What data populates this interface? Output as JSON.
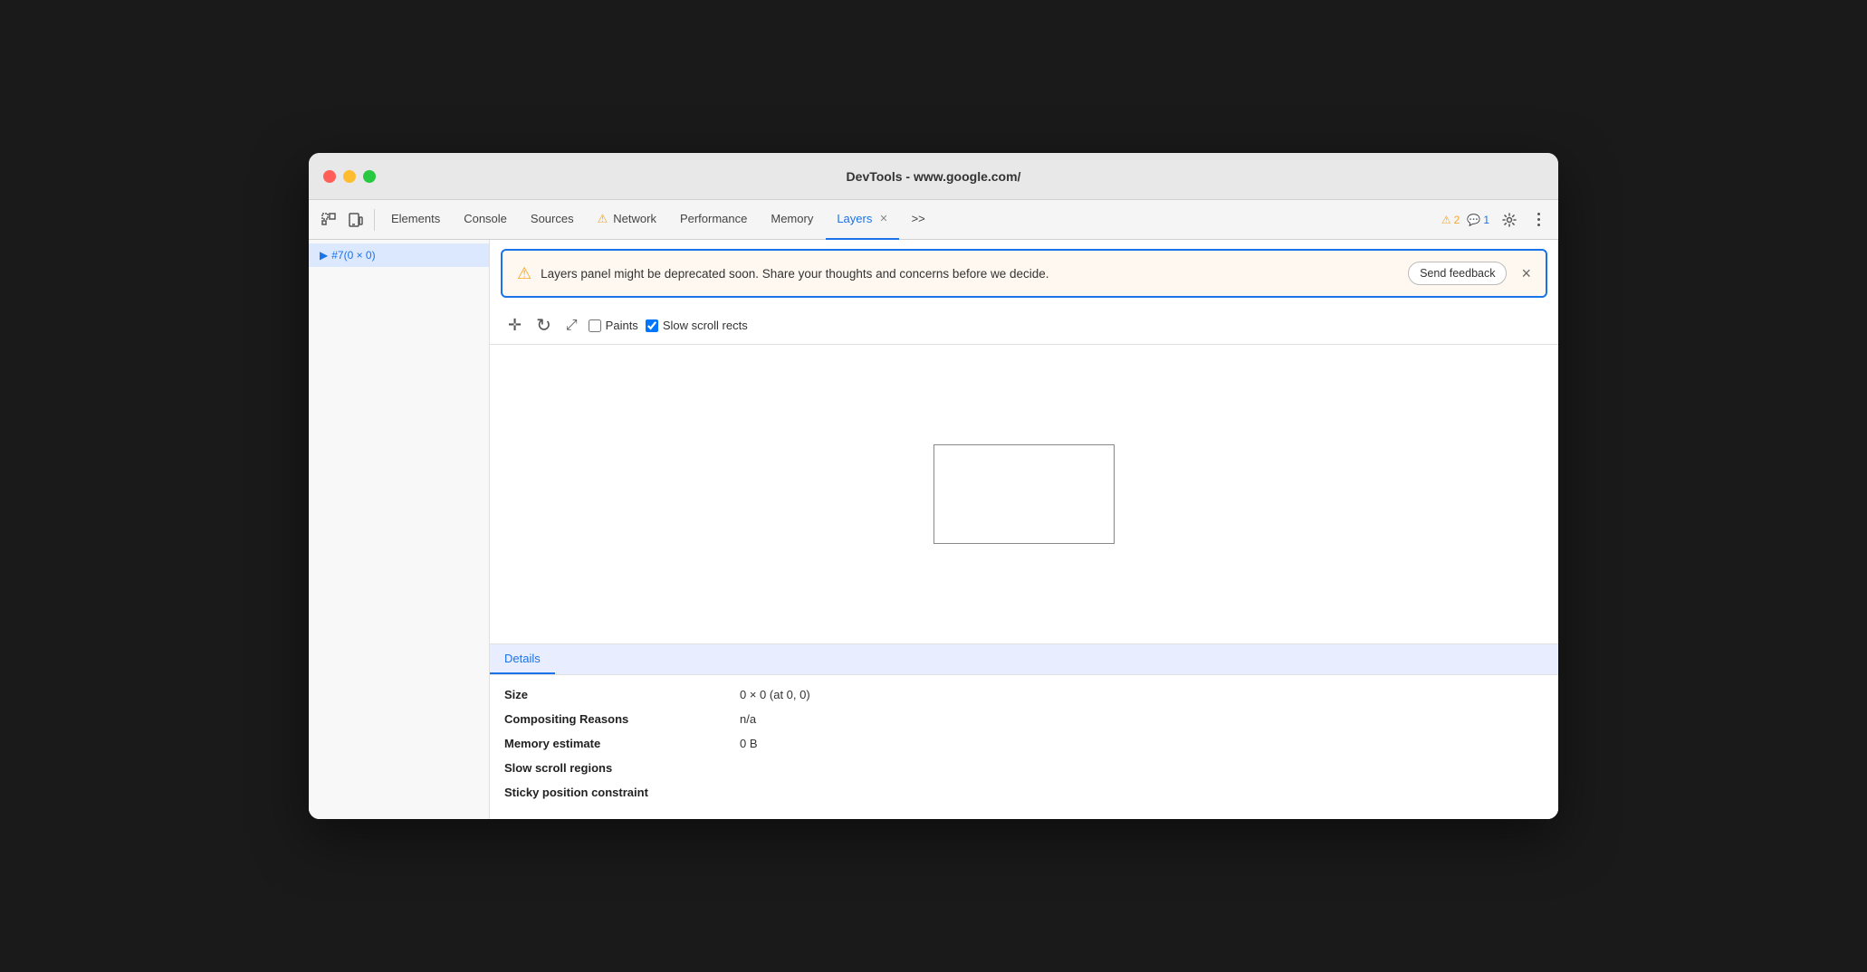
{
  "window": {
    "title": "DevTools - www.google.com/"
  },
  "toolbar": {
    "inspect_label": "Inspect",
    "device_label": "Device",
    "tabs": [
      {
        "id": "elements",
        "label": "Elements",
        "active": false
      },
      {
        "id": "console",
        "label": "Console",
        "active": false
      },
      {
        "id": "sources",
        "label": "Sources",
        "active": false
      },
      {
        "id": "network",
        "label": "Network",
        "active": false,
        "warning": true
      },
      {
        "id": "performance",
        "label": "Performance",
        "active": false
      },
      {
        "id": "memory",
        "label": "Memory",
        "active": false
      },
      {
        "id": "layers",
        "label": "Layers",
        "active": true,
        "closeable": true
      }
    ],
    "more_tabs": ">>",
    "warning_count": "2",
    "info_count": "1",
    "settings_label": "Settings",
    "more_options_label": "More options"
  },
  "sidebar": {
    "items": [
      {
        "id": "layer1",
        "label": "#7(0 × 0)",
        "selected": true,
        "expandable": true
      }
    ]
  },
  "banner": {
    "message": "Layers panel might be deprecated soon. Share your thoughts and concerns before we decide.",
    "send_feedback_label": "Send feedback",
    "close_label": "×"
  },
  "layers_toolbar": {
    "pan_label": "Pan",
    "rotate_label": "Rotate",
    "resize_label": "Resize",
    "paints_label": "Paints",
    "paints_checked": false,
    "slow_scroll_label": "Slow scroll rects",
    "slow_scroll_checked": true
  },
  "details": {
    "header": "Details",
    "rows": [
      {
        "key": "Size",
        "value": "0 × 0 (at 0, 0)"
      },
      {
        "key": "Compositing Reasons",
        "value": "n/a"
      },
      {
        "key": "Memory estimate",
        "value": "0 B"
      },
      {
        "key": "Slow scroll regions",
        "value": ""
      },
      {
        "key": "Sticky position constraint",
        "value": ""
      }
    ]
  }
}
